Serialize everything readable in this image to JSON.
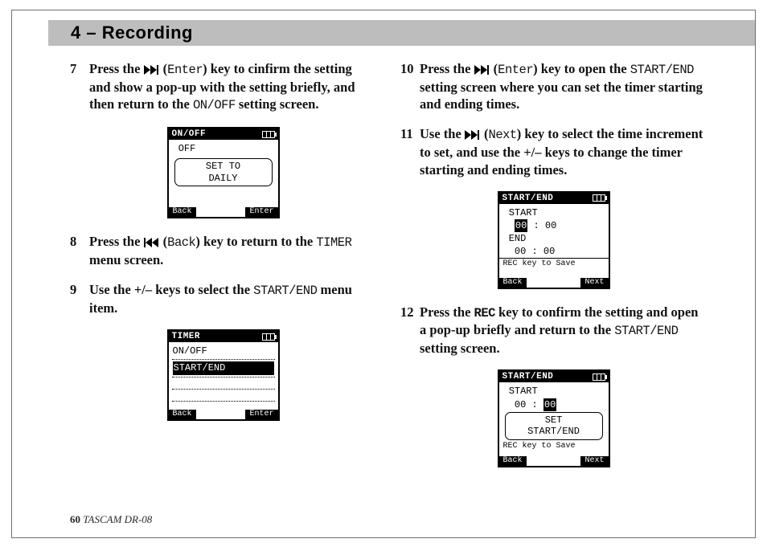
{
  "header": {
    "title": "4 – Recording"
  },
  "left": {
    "steps": [
      {
        "num": "7",
        "pre": "Press the ",
        "key": "Enter",
        "mid1": ") key to cinfirm the setting and show a pop-up with the setting briefly, and then return to the ",
        "mono1": "ON/OFF",
        "tail": " setting screen."
      },
      {
        "num": "8",
        "pre": "Press the ",
        "key": "Back",
        "mid1": ") key to return to the ",
        "mono1": "TIMER",
        "tail": " menu screen."
      },
      {
        "num": "9",
        "pre": "Use the +/– keys to select the ",
        "mono1": "START/END",
        "tail": " menu item."
      }
    ],
    "lcd1": {
      "title": "ON/OFF",
      "line1": "OFF",
      "popup1": "SET TO",
      "popup2": "DAILY",
      "skL": "Back",
      "skR": "Enter"
    },
    "lcd2": {
      "title": "TIMER",
      "row1": "ON/OFF",
      "row2": "START/END",
      "skL": "Back",
      "skR": "Enter"
    }
  },
  "right": {
    "steps": [
      {
        "num": "10",
        "pre": "Press the ",
        "key": "Enter",
        "mid1": ") key to open the ",
        "mono1": "START/END",
        "tail": " setting screen where you can set the timer starting and ending times."
      },
      {
        "num": "11",
        "pre": "Use the ",
        "key": "Next",
        "mid1": ") key to select the time increment to set, and use the +/– keys to change the timer starting and ending times."
      },
      {
        "num": "12",
        "pre": "Press the ",
        "keymono": "REC",
        "mid1": " key to confirm the setting and open a pop-up briefly and return to the ",
        "mono1": "START/END",
        "tail": " setting screen."
      }
    ],
    "lcd1": {
      "title": "START/END",
      "l1": "START",
      "l2a": "00",
      "l2b": " : 00",
      "l3": "END",
      "l4": " 00 : 00",
      "l5": "REC key to Save",
      "skL": "Back",
      "skR": "Next"
    },
    "lcd2": {
      "title": "START/END",
      "l1": "START",
      "l2": " 00 : ",
      "l2b": "00",
      "popup1": "SET",
      "popup2": "START/END",
      "l5": "REC key to Save",
      "skL": "Back",
      "skR": "Next"
    }
  },
  "footer": {
    "page": "60",
    "model": " TASCAM  DR-08"
  }
}
